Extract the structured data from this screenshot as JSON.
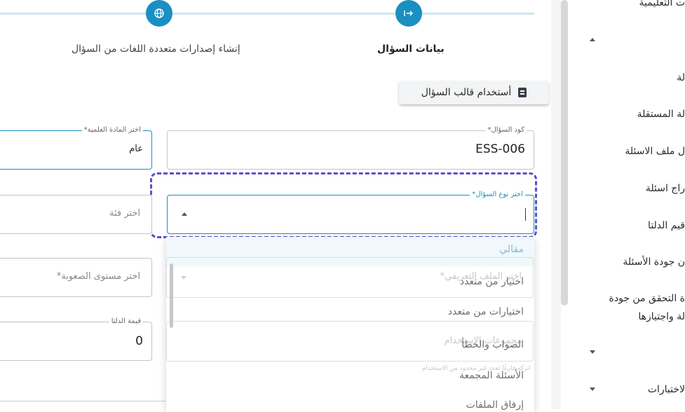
{
  "stepper": {
    "step1_label": "بيانات السؤال",
    "step2_label": "إنشاء إصدارات متعددة اللغات من السؤال"
  },
  "template_button": {
    "label": "أستخدام قالب السؤال",
    "icon": "document-icon"
  },
  "form": {
    "question_code": {
      "label": "كود السؤال*",
      "value": "ESS-006"
    },
    "subject": {
      "label": "اختر المادة العلمية*",
      "value": "عام"
    },
    "question_type": {
      "label": "اختر نوع السؤال*",
      "value": ""
    },
    "category": {
      "placeholder": "اختر فئة"
    },
    "difficulty": {
      "placeholder": "اختر مستوى الصعوبة*"
    },
    "delta": {
      "label": "قيمة الدلتا",
      "value": "0"
    }
  },
  "question_type_menu": {
    "options": [
      "مقالي",
      "اختيار من متعدد",
      "اختيارات من متعدد",
      "الصواب والخطأ",
      "الأسئلة المجمعة",
      "إرفاق الملفات"
    ]
  },
  "ghost_fields": {
    "definition_file": "اختر الملف التعريفي*",
    "usage_count": "مجموعات الاستخدام",
    "usage_hint": "اتركه فارغًا لعدد غير محدود من الاستخدام"
  },
  "sidebar": {
    "items": [
      "ت التعليمية",
      "لة",
      "لة المستقلة",
      "ل ملف الاسئلة",
      "راج اسئلة",
      "قيم الدلتا",
      "ن جودة الأسئلة",
      "ة التحقق من جودة",
      "لة واجتيازها",
      "لاختبارات"
    ]
  },
  "colors": {
    "accent": "#1a8fc1",
    "focus_outline": "#5b4fcf"
  }
}
